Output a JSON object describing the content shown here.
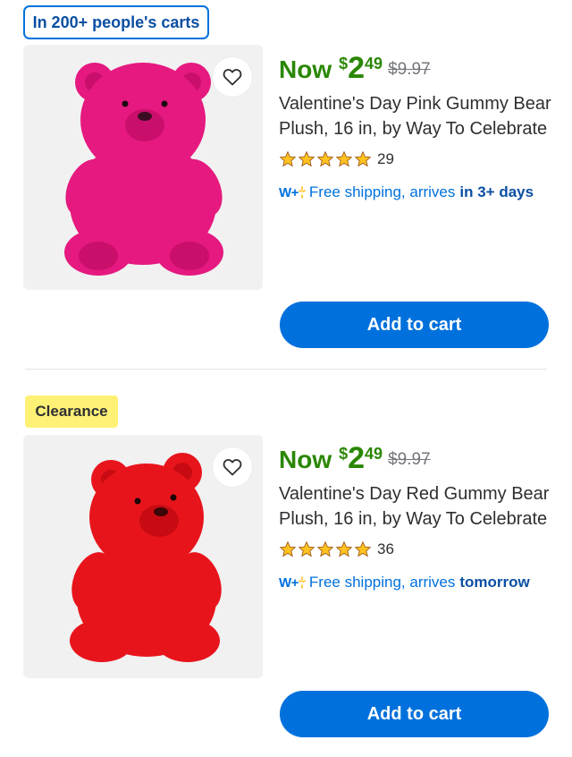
{
  "products": [
    {
      "badge": "In 200+ people's carts",
      "now_label": "Now",
      "currency": "$",
      "price_whole": "2",
      "price_cents": "49",
      "was_price": "$9.97",
      "title": "Valentine's Day Pink Gummy Bear Plush, 16 in, by Way To Celebrate",
      "rating_stars": 5,
      "rating_count": "29",
      "shipping_prefix": "Free shipping, arrives",
      "shipping_when": "in 3+ days",
      "add_to_cart_label": "Add to cart",
      "bear_color": "#e5197f",
      "bear_shade": "#c90f6b"
    },
    {
      "badge": "Clearance",
      "now_label": "Now",
      "currency": "$",
      "price_whole": "2",
      "price_cents": "49",
      "was_price": "$9.97",
      "title": "Valentine's Day Red Gummy Bear Plush, 16 in, by Way To Celebrate",
      "rating_stars": 5,
      "rating_count": "36",
      "shipping_prefix": "Free shipping, arrives",
      "shipping_when": "tomorrow",
      "add_to_cart_label": "Add to cart",
      "bear_color": "#e8141c",
      "bear_shade": "#c80b12"
    }
  ],
  "icons": {
    "favorite": "heart-outline-icon",
    "star": "star-filled-icon",
    "walmart_plus": "walmart-plus-icon"
  },
  "colors": {
    "price_green": "#2a8703",
    "walmart_blue": "#0071dc",
    "star_gold": "#ffc220",
    "clearance_yellow": "#fff176"
  }
}
